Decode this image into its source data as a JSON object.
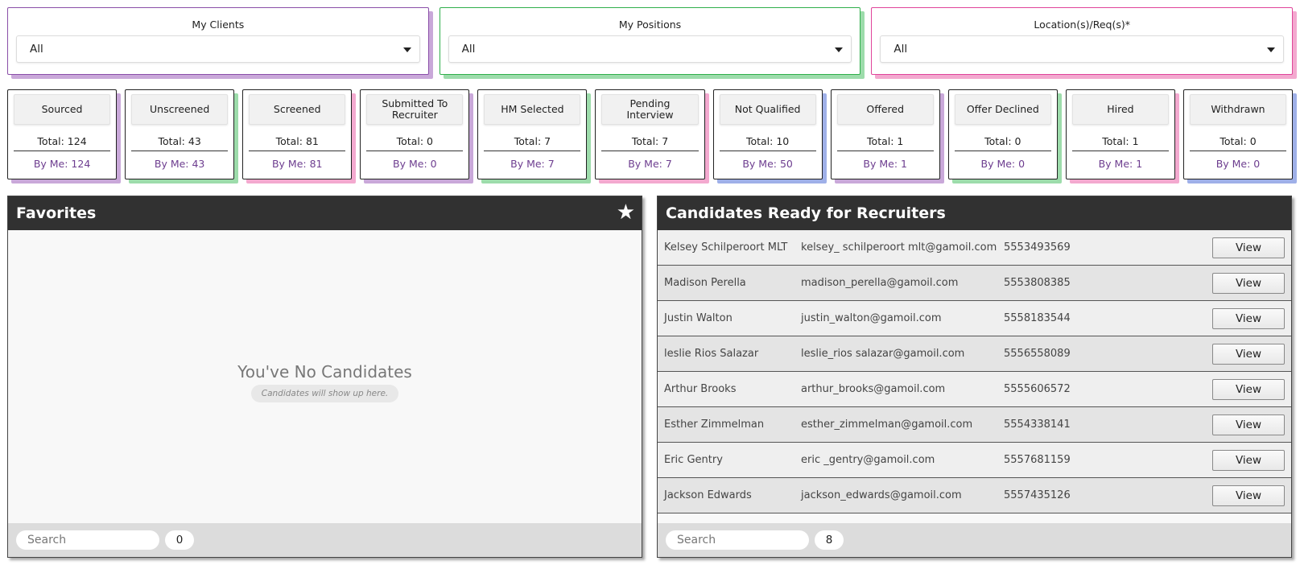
{
  "filters": [
    {
      "label": "My Clients",
      "value": "All",
      "color": "purple"
    },
    {
      "label": "My Positions",
      "value": "All",
      "color": "green"
    },
    {
      "label": "Location(s)/Req(s)*",
      "value": "All",
      "color": "pink"
    }
  ],
  "statuses": [
    {
      "label": "Sourced",
      "total": "Total: 124",
      "by_me": "By Me: 124",
      "color": "purple"
    },
    {
      "label": "Unscreened",
      "total": "Total: 43",
      "by_me": "By Me: 43",
      "color": "green"
    },
    {
      "label": "Screened",
      "total": "Total: 81",
      "by_me": "By Me: 81",
      "color": "pink"
    },
    {
      "label": "Submitted To Recruiter",
      "total": "Total: 0",
      "by_me": "By Me: 0",
      "color": "purple"
    },
    {
      "label": "HM Selected",
      "total": "Total: 7",
      "by_me": "By Me: 7",
      "color": "green"
    },
    {
      "label": "Pending Interview",
      "total": "Total: 7",
      "by_me": "By Me: 7",
      "color": "pink"
    },
    {
      "label": "Not Qualified",
      "total": "Total: 10",
      "by_me": "By Me: 50",
      "color": "blue"
    },
    {
      "label": "Offered",
      "total": "Total: 1",
      "by_me": "By Me: 1",
      "color": "purple"
    },
    {
      "label": "Offer Declined",
      "total": "Total: 0",
      "by_me": "By Me: 0",
      "color": "green"
    },
    {
      "label": "Hired",
      "total": "Total: 1",
      "by_me": "By Me: 1",
      "color": "pink"
    },
    {
      "label": "Withdrawn",
      "total": "Total: 0",
      "by_me": "By Me: 0",
      "color": "blue"
    }
  ],
  "favorites": {
    "title": "Favorites",
    "star_icon": "star-icon",
    "empty_title": "You've No Candidates",
    "empty_subtitle": "Candidates will show up here.",
    "search_placeholder": "Search",
    "count": "0"
  },
  "ready": {
    "title": "Candidates Ready for Recruiters",
    "view_label": "View",
    "search_placeholder": "Search",
    "count": "8",
    "rows": [
      {
        "name": "Kelsey Schilperoort MLT",
        "email": "kelsey_ schilperoort mlt@gamoil.com",
        "phone": "5553493569"
      },
      {
        "name": "Madison Perella",
        "email": "madison_perella@gamoil.com",
        "phone": "5553808385"
      },
      {
        "name": "Justin Walton",
        "email": "justin_walton@gamoil.com",
        "phone": "5558183544"
      },
      {
        "name": "leslie Rios Salazar",
        "email": "leslie_rios salazar@gamoil.com",
        "phone": "5556558089"
      },
      {
        "name": "Arthur Brooks",
        "email": "arthur_brooks@gamoil.com",
        "phone": "5555606572"
      },
      {
        "name": "Esther Zimmelman",
        "email": "esther_zimmelman@gamoil.com",
        "phone": "5554338141"
      },
      {
        "name": "Eric Gentry",
        "email": "eric _gentry@gamoil.com",
        "phone": "5557681159"
      },
      {
        "name": "Jackson Edwards",
        "email": "jackson_edwards@gamoil.com",
        "phone": "5557435126"
      }
    ]
  }
}
